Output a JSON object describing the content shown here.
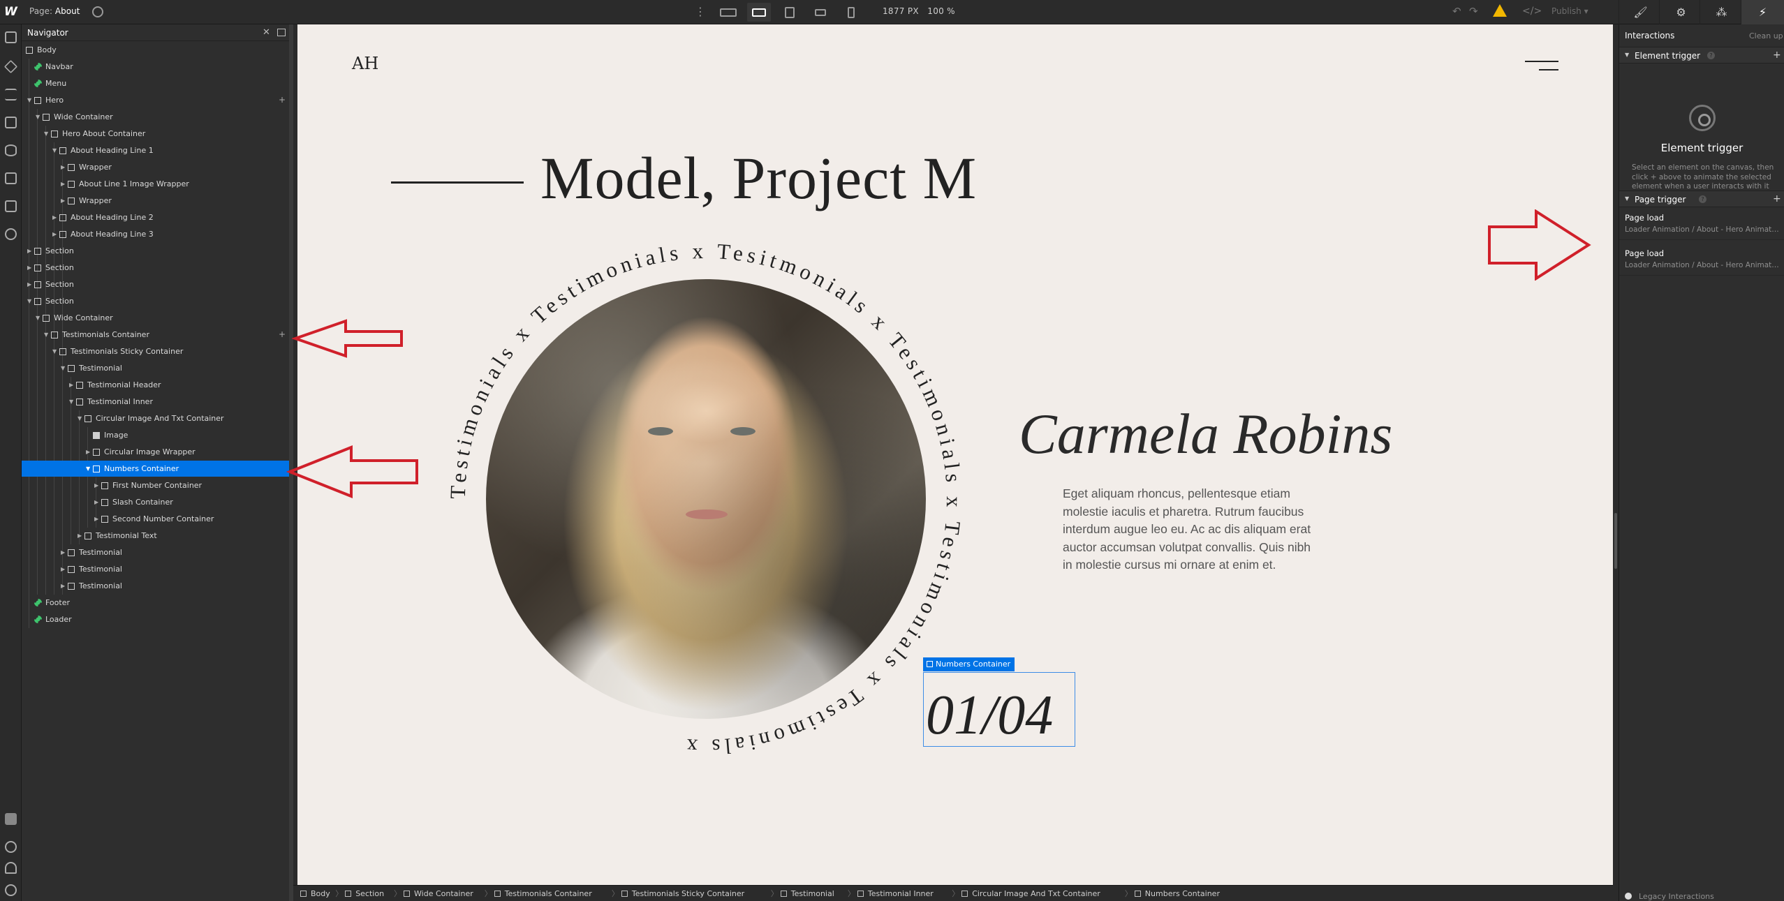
{
  "topbar": {
    "logo": "W",
    "page_prefix": "Page:",
    "page_name": "About",
    "canvas_width": "1877 PX",
    "zoom": "100 %",
    "publish_label": "Publish",
    "warning_color": "#f2b700",
    "right_tabs": [
      {
        "name": "style-tab",
        "icon": "brush-icon"
      },
      {
        "name": "settings-tab",
        "icon": "gear-icon"
      },
      {
        "name": "style-manager-tab",
        "icon": "drops-icon"
      },
      {
        "name": "interactions-tab",
        "icon": "bolt-icon"
      }
    ]
  },
  "navigator": {
    "title": "Navigator",
    "selected_color": "#0073e6",
    "tree": [
      {
        "label": "Body",
        "depth": 0,
        "icon": "box",
        "caret": ""
      },
      {
        "label": "Navbar",
        "depth": 1,
        "icon": "symbol",
        "caret": ""
      },
      {
        "label": "Menu",
        "depth": 1,
        "icon": "symbol",
        "caret": ""
      },
      {
        "label": "Hero",
        "depth": 1,
        "icon": "box",
        "caret": "open",
        "plus": true
      },
      {
        "label": "Wide Container",
        "depth": 2,
        "icon": "box",
        "caret": "open"
      },
      {
        "label": "Hero About Container",
        "depth": 3,
        "icon": "box",
        "caret": "open"
      },
      {
        "label": "About Heading Line 1",
        "depth": 4,
        "icon": "box",
        "caret": "open"
      },
      {
        "label": "Wrapper",
        "depth": 5,
        "icon": "box",
        "caret": "closed"
      },
      {
        "label": "About Line 1 Image Wrapper",
        "depth": 5,
        "icon": "box",
        "caret": "closed"
      },
      {
        "label": "Wrapper",
        "depth": 5,
        "icon": "box",
        "caret": "closed"
      },
      {
        "label": "About Heading Line 2",
        "depth": 4,
        "icon": "box",
        "caret": "closed"
      },
      {
        "label": "About Heading Line 3",
        "depth": 4,
        "icon": "box",
        "caret": "closed"
      },
      {
        "label": "Section",
        "depth": 1,
        "icon": "box",
        "caret": "closed"
      },
      {
        "label": "Section",
        "depth": 1,
        "icon": "box",
        "caret": "closed"
      },
      {
        "label": "Section",
        "depth": 1,
        "icon": "box",
        "caret": "closed"
      },
      {
        "label": "Section",
        "depth": 1,
        "icon": "box",
        "caret": "open"
      },
      {
        "label": "Wide Container",
        "depth": 2,
        "icon": "box",
        "caret": "open"
      },
      {
        "label": "Testimonials Container",
        "depth": 3,
        "icon": "box",
        "caret": "open",
        "plus": true
      },
      {
        "label": "Testimonials Sticky Container",
        "depth": 4,
        "icon": "box",
        "caret": "open"
      },
      {
        "label": "Testimonial",
        "depth": 5,
        "icon": "box",
        "caret": "open"
      },
      {
        "label": "Testimonial Header",
        "depth": 6,
        "icon": "box",
        "caret": "closed"
      },
      {
        "label": "Testimonial Inner",
        "depth": 6,
        "icon": "box",
        "caret": "open"
      },
      {
        "label": "Circular Image And Txt Container",
        "depth": 7,
        "icon": "box",
        "caret": "open"
      },
      {
        "label": "Image",
        "depth": 8,
        "icon": "image",
        "caret": ""
      },
      {
        "label": "Circular Image Wrapper",
        "depth": 8,
        "icon": "box",
        "caret": "closed"
      },
      {
        "label": "Numbers Container",
        "depth": 8,
        "icon": "box",
        "caret": "open",
        "selected": true
      },
      {
        "label": "First Number Container",
        "depth": 9,
        "icon": "box",
        "caret": "closed"
      },
      {
        "label": "Slash Container",
        "depth": 9,
        "icon": "box",
        "caret": "closed"
      },
      {
        "label": "Second Number Container",
        "depth": 9,
        "icon": "box",
        "caret": "closed"
      },
      {
        "label": "Testimonial Text",
        "depth": 7,
        "icon": "box",
        "caret": "closed"
      },
      {
        "label": "Testimonial",
        "depth": 5,
        "icon": "box",
        "caret": "closed"
      },
      {
        "label": "Testimonial",
        "depth": 5,
        "icon": "box",
        "caret": "closed"
      },
      {
        "label": "Testimonial",
        "depth": 5,
        "icon": "box",
        "caret": "closed"
      },
      {
        "label": "Footer",
        "depth": 1,
        "icon": "symbol",
        "caret": ""
      },
      {
        "label": "Loader",
        "depth": 1,
        "icon": "symbol",
        "caret": ""
      }
    ]
  },
  "canvas": {
    "brand": "AH",
    "hero_title": "Model, Project M",
    "ring_text": "Testimonials x Testimonials x Tesitmonials x Testimonials x Testimonials x Testimonials x ",
    "name": "Carmela Robins",
    "paragraph": "Eget aliquam rhoncus, pellentesque etiam molestie iaculis et pharetra. Rutrum faucibus interdum augue leo eu. Ac ac dis aliquam erat auctor accumsan volutpat convallis. Quis nibh in molestie cursus mi ornare at enim et.",
    "numbers_tag": "Numbers Container",
    "numbers": "01/04",
    "background": "#f2ede9"
  },
  "breadcrumb": [
    "Body",
    "Section",
    "Wide Container",
    "Testimonials Container",
    "Testimonials Sticky Container",
    "Testimonial",
    "Testimonial Inner",
    "Circular Image And Txt Container",
    "Numbers Container"
  ],
  "interactions": {
    "title": "Interactions",
    "cleanup": "Clean up",
    "element_trigger_header": "Element trigger",
    "element_trigger_title": "Element trigger",
    "element_trigger_desc": "Select an element on the canvas, then click + above to animate the selected element when a user interacts with it (such as on hover or click).",
    "page_trigger_header": "Page trigger",
    "page_loads": [
      {
        "title": "Page load",
        "detail": "Loader Animation / About - Hero Animation"
      },
      {
        "title": "Page load",
        "detail": "Loader Animation / About - Hero Animation"
      }
    ],
    "legacy": "Legacy Interactions"
  },
  "annotations": {
    "arrow_color": "#d0202a"
  }
}
